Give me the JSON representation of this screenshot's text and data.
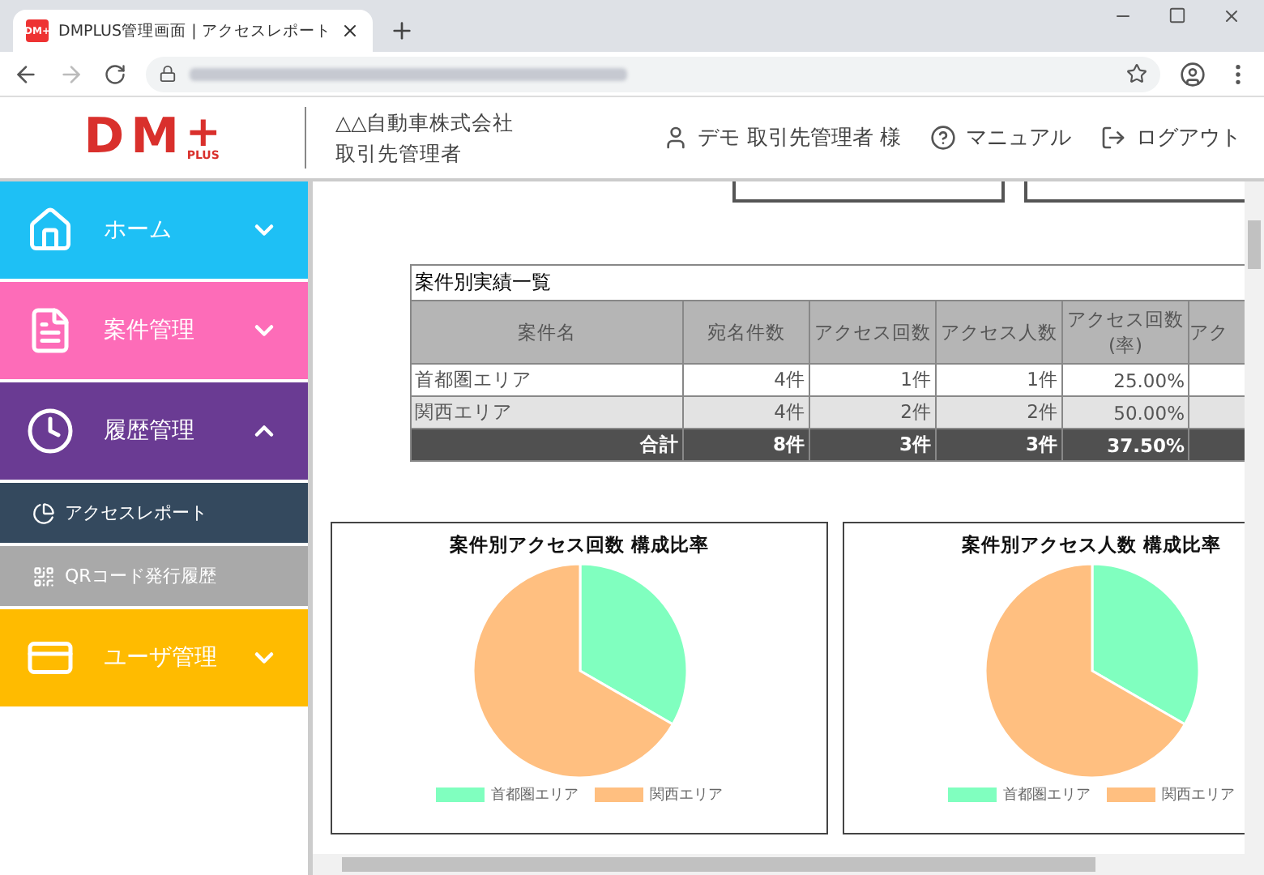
{
  "browser": {
    "tab_title": "DMPLUS管理画面 | アクセスレポート",
    "tab_icon_text": "DM+"
  },
  "header": {
    "logo": {
      "text": "DM",
      "mark": "+",
      "sub": "PLUS"
    },
    "company": "△△自動車株式会社",
    "role": "取引先管理者",
    "links": [
      {
        "kind": "user",
        "label": "デモ 取引先管理者 様"
      },
      {
        "kind": "help",
        "label": "マニュアル"
      },
      {
        "kind": "logout",
        "label": "ログアウト"
      }
    ]
  },
  "sidebar": {
    "items": [
      {
        "kind": "home",
        "label": "ホーム",
        "expanded": false,
        "color": "#1ec0f5"
      },
      {
        "kind": "file",
        "label": "案件管理",
        "expanded": false,
        "color": "#fd6cb8"
      },
      {
        "kind": "clock",
        "label": "履歴管理",
        "expanded": true,
        "color": "#6a3b93",
        "children": [
          {
            "kind": "pie",
            "label": "アクセスレポート",
            "selected": true
          },
          {
            "kind": "qr",
            "label": "QRコード発行履歴",
            "selected": false
          }
        ]
      },
      {
        "kind": "card",
        "label": "ユーザ管理",
        "expanded": false,
        "color": "#ffbb00"
      }
    ]
  },
  "table": {
    "caption": "案件別実績一覧",
    "columns": [
      "案件名",
      "宛名件数",
      "アクセス回数",
      "アクセス人数",
      "アクセス回数\n(率)",
      "アク"
    ],
    "rows": [
      [
        "首都圏エリア",
        "4件",
        "1件",
        "1件",
        "25.00%"
      ],
      [
        "関西エリア",
        "4件",
        "2件",
        "2件",
        "50.00%"
      ]
    ],
    "total": [
      "合計",
      "8件",
      "3件",
      "3件",
      "37.50%"
    ]
  },
  "charts": [
    {
      "chart_data": {
        "type": "pie",
        "title": "案件別アクセス回数 構成比率",
        "categories": [
          "首都圏エリア",
          "関西エリア"
        ],
        "values": [
          33.33,
          66.67
        ],
        "colors": [
          "#80ffbf",
          "#ffbf80"
        ]
      }
    },
    {
      "chart_data": {
        "type": "pie",
        "title": "案件別アクセス人数 構成比率",
        "categories": [
          "首都圏エリア",
          "関西エリア"
        ],
        "values": [
          33.33,
          66.67
        ],
        "colors": [
          "#80ffbf",
          "#ffbf80"
        ]
      }
    }
  ]
}
